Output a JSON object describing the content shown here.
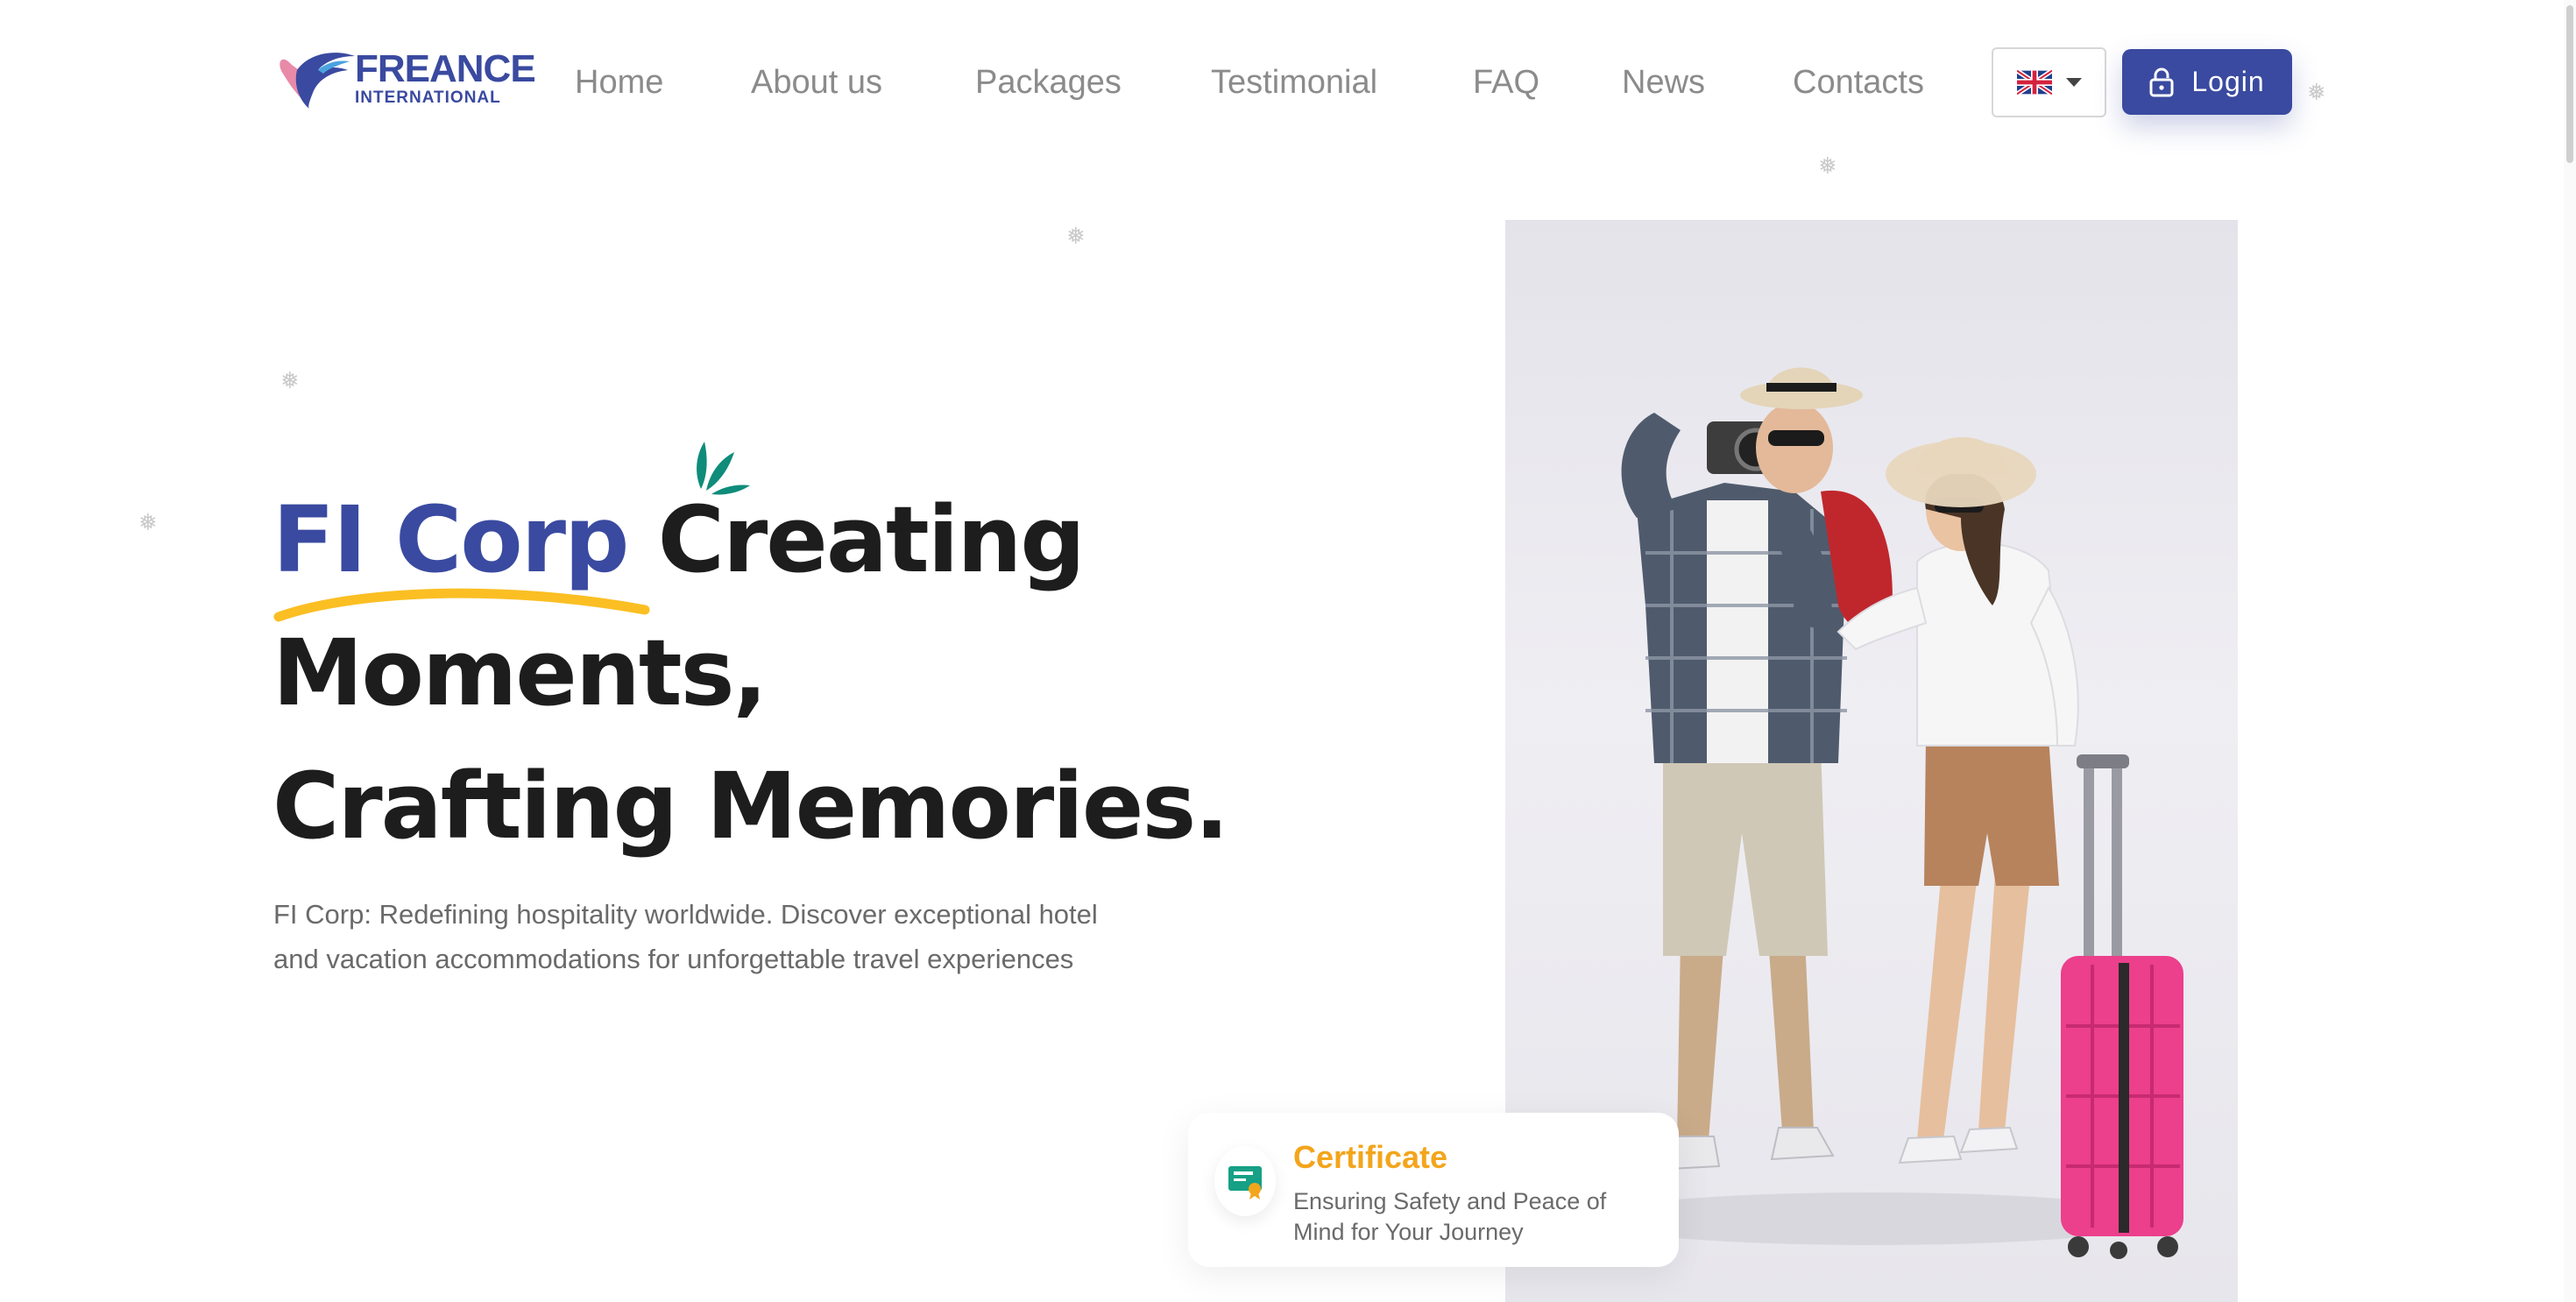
{
  "logo": {
    "word": "FREANCE",
    "sub": "INTERNATIONAL",
    "icon": "bird-logo-icon"
  },
  "nav": {
    "items": [
      {
        "label": "Home"
      },
      {
        "label": "About us"
      },
      {
        "label": "Packages"
      },
      {
        "label": "Testimonial"
      },
      {
        "label": "FAQ"
      },
      {
        "label": "News"
      },
      {
        "label": "Contacts"
      }
    ]
  },
  "language": {
    "selected_icon": "uk-flag-icon",
    "menu_icon": "caret-down-icon"
  },
  "login": {
    "label": "Login",
    "icon": "lock-icon"
  },
  "hero": {
    "brand": "FI Corp",
    "line1_rest": "Creating",
    "line2": "Moments,",
    "line3": "Crafting Memories.",
    "description": "FI Corp: Redefining hospitality worldwide. Discover exceptional hotel and vacation accommodations for unforgettable travel experiences",
    "photo_icon": "travel-couple-photo"
  },
  "certificate": {
    "title": "Certificate",
    "text": "Ensuring Safety and Peace of Mind for Your Journey",
    "icon": "certificate-icon"
  },
  "colors": {
    "brand_blue": "#3a4aa0",
    "accent_yellow": "#fbbf24",
    "accent_teal": "#0f8c7a",
    "certificate_orange": "#f3a51c",
    "text_dark": "#1d1d1d",
    "text_muted": "#6a6a6a",
    "nav_gray": "#8b8b8b"
  }
}
